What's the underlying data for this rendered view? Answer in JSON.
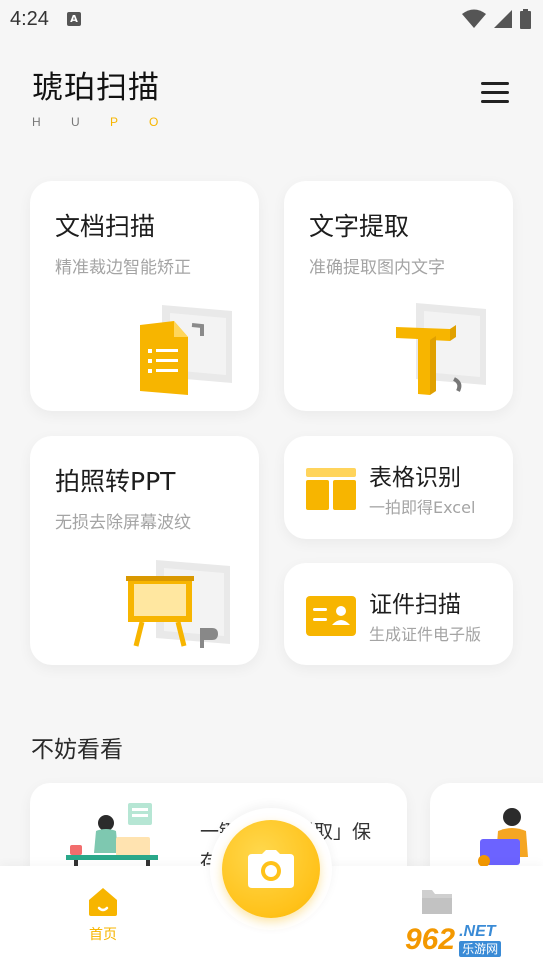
{
  "status_bar": {
    "time": "4:24",
    "notification_badge": "A",
    "icons": [
      "wifi-icon",
      "signal-icon",
      "battery-icon"
    ]
  },
  "brand": {
    "title": "琥珀扫描",
    "letters": [
      "H",
      "U",
      "P",
      "O"
    ],
    "highlight_color": "#f7b500"
  },
  "cards": {
    "doc_scan": {
      "title": "文档扫描",
      "subtitle": "精准裁边智能矫正"
    },
    "text_extract": {
      "title": "文字提取",
      "subtitle": "准确提取图内文字"
    },
    "photo_ppt": {
      "title": "拍照转PPT",
      "subtitle": "无损去除屏幕波纹"
    },
    "table_recog": {
      "title": "表格识别",
      "subtitle": "一拍即得Excel"
    },
    "id_scan": {
      "title": "证件扫描",
      "subtitle": "生成证件电子版"
    }
  },
  "section": {
    "title": "不妨看看"
  },
  "recommend": {
    "items": [
      {
        "text": "一键「文字提取」保存"
      }
    ]
  },
  "bottom_nav": {
    "home_label": "首页",
    "accent_color": "#f7b500"
  },
  "watermark": {
    "num": "962",
    "net": ".NET",
    "cn": "乐游网"
  }
}
